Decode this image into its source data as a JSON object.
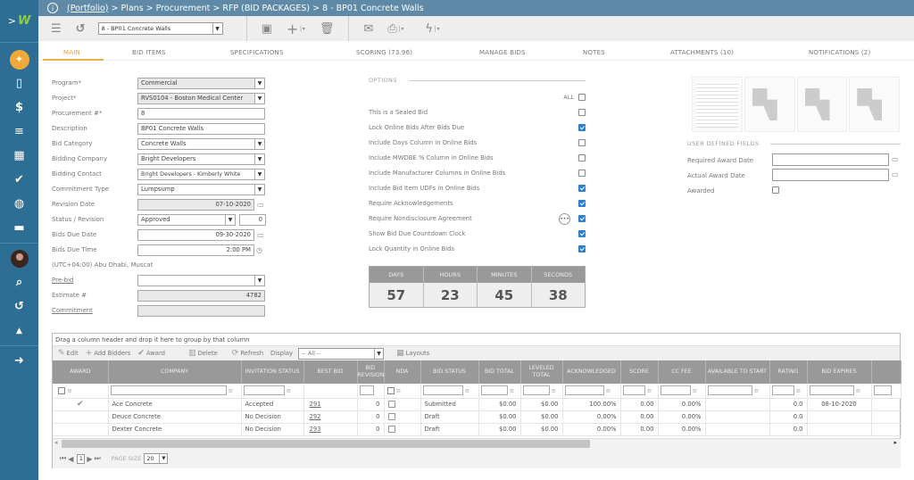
{
  "sidebar": {
    "expand": ">",
    "logo": "W",
    "items": [
      {
        "name": "lightbulb",
        "glyph": "💡"
      },
      {
        "name": "document",
        "glyph": "▯"
      },
      {
        "name": "dollar",
        "glyph": "$"
      },
      {
        "name": "bars",
        "glyph": "≡"
      },
      {
        "name": "building",
        "glyph": "▦"
      },
      {
        "name": "check",
        "glyph": "✔"
      },
      {
        "name": "globe",
        "glyph": "◍"
      },
      {
        "name": "briefcase",
        "glyph": "▬"
      },
      {
        "name": "search",
        "glyph": "⌕"
      },
      {
        "name": "history",
        "glyph": "↺"
      },
      {
        "name": "graduation",
        "glyph": "▲"
      },
      {
        "name": "logout",
        "glyph": "➜"
      }
    ]
  },
  "breadcrumb": {
    "portfolio": "(Portfolio)",
    "rest": "> Plans > Procurement > RFP (BID PACKAGES) > 8 - BP01 Concrete Walls"
  },
  "toolbar": {
    "record_select": "8 -  BP01 Concrete Walls"
  },
  "tabs": [
    "MAIN",
    "BID ITEMS",
    "SPECIFICATIONS",
    "SCORING (73.96)",
    "MANAGE BIDS",
    "NOTES",
    "ATTACHMENTS (10)",
    "NOTIFICATIONS (2)"
  ],
  "form": {
    "program": {
      "label": "Program*",
      "value": "Commercial"
    },
    "project": {
      "label": "Project*",
      "value": "RVS0104 - Boston Medical Center"
    },
    "procurement": {
      "label": "Procurement #*",
      "value": "8"
    },
    "description": {
      "label": "Description",
      "value": "BP01 Concrete Walls"
    },
    "bid_category": {
      "label": "Bid Category",
      "value": "Concrete Walls"
    },
    "bidding_company": {
      "label": "Bidding Company",
      "value": "Bright Developers"
    },
    "bidding_contact": {
      "label": "Bidding Contact",
      "value": "Bright Developers - Kimberly White"
    },
    "commitment_type": {
      "label": "Commitment Type",
      "value": "Lumpsump"
    },
    "revision_date": {
      "label": "Revision Date",
      "value": "07-10-2020"
    },
    "status_revision": {
      "label": "Status / Revision",
      "value": "Approved",
      "revision": "0"
    },
    "bids_due_date": {
      "label": "Bids Due Date",
      "value": "09-30-2020"
    },
    "bids_due_time": {
      "label": "Bids Due Time",
      "value": "2:00 PM"
    },
    "timezone": "(UTC+04:00) Abu Dhabi, Muscat",
    "pre_bid": {
      "label": "Pre-bid",
      "value": ""
    },
    "estimate": {
      "label": "Estimate #",
      "value": "4782"
    },
    "commitment": {
      "label": "Commitment",
      "value": ""
    }
  },
  "options": {
    "heading": "OPTIONS",
    "all_label": "ALL",
    "all_checked": false,
    "items": [
      {
        "label": "This is a Sealed Bid",
        "checked": false
      },
      {
        "label": "Lock Online Bids After Bids Due",
        "checked": true
      },
      {
        "label": "Include Days Column in Online Bids",
        "checked": false
      },
      {
        "label": "Include MWDBE % Column in Online Bids",
        "checked": false
      },
      {
        "label": "Include Manufacturer Columns in Online Bids",
        "checked": false
      },
      {
        "label": "Include Bid Item UDFs in Online Bids",
        "checked": true
      },
      {
        "label": "Require Acknowledgements",
        "checked": true
      },
      {
        "label": "Require Nondisclosure Agreement",
        "checked": true,
        "more": "•••"
      },
      {
        "label": "Show Bid Due Countdown Clock",
        "checked": true
      },
      {
        "label": "Lock Quantity in Online Bids",
        "checked": true
      }
    ]
  },
  "countdown": [
    {
      "label": "DAYS",
      "value": "57"
    },
    {
      "label": "HOURS",
      "value": "23"
    },
    {
      "label": "MINUTES",
      "value": "45"
    },
    {
      "label": "SECONDS",
      "value": "38"
    }
  ],
  "udf": {
    "heading": "USER DEFINED FIELDS",
    "required_award_date": {
      "label": "Required Award Date",
      "value": ""
    },
    "actual_award_date": {
      "label": "Actual Award Date",
      "value": ""
    },
    "awarded": {
      "label": "Awarded",
      "checked": false
    }
  },
  "grid": {
    "group_hint": "Drag a column header and drop it here to group by that column",
    "toolbar": {
      "edit": "Edit",
      "add_bidders": "Add Bidders",
      "award": "Award",
      "delete": "Delete",
      "refresh": "Refresh",
      "display": "Display",
      "display_value": "-- All --",
      "layouts": "Layouts"
    },
    "columns": [
      "AWARD",
      "COMPANY",
      "INVITATION STATUS",
      "BEST BID",
      "BID REVISION",
      "NDA",
      "BID STATUS",
      "BID TOTAL",
      "LEVELED TOTAL",
      "ACKNOWLEDGED",
      "SCORE",
      "CC FEE",
      "AVAILABLE TO START",
      "RATING",
      "BID EXPIRES",
      ""
    ],
    "rows": [
      {
        "award": "✔",
        "company": "Ace Concrete",
        "invitation_status": "Accepted",
        "best_bid": "291",
        "bid_revision": "0",
        "nda": false,
        "bid_status": "Submitted",
        "bid_total": "$0.00",
        "leveled_total": "$0.00",
        "acknowledged": "100.00%",
        "score": "0.00",
        "cc_fee": "0.00%",
        "available_to_start": "",
        "rating": "0.0",
        "bid_expires": "08-10-2020"
      },
      {
        "award": "",
        "company": "Deuce Concrete",
        "invitation_status": "No Decision",
        "best_bid": "292",
        "bid_revision": "0",
        "nda": false,
        "bid_status": "Draft",
        "bid_total": "$0.00",
        "leveled_total": "$0.00",
        "acknowledged": "0.00%",
        "score": "0.00",
        "cc_fee": "0.00%",
        "available_to_start": "",
        "rating": "0.0",
        "bid_expires": ""
      },
      {
        "award": "",
        "company": "Dexter Concrete",
        "invitation_status": "No Decision",
        "best_bid": "293",
        "bid_revision": "0",
        "nda": false,
        "bid_status": "Draft",
        "bid_total": "$0.00",
        "leveled_total": "$0.00",
        "acknowledged": "0.00%",
        "score": "0.00",
        "cc_fee": "0.00%",
        "available_to_start": "",
        "rating": "0.0",
        "bid_expires": ""
      }
    ],
    "pager": {
      "page": "1",
      "page_size_label": "PAGE SIZE",
      "page_size": "20"
    }
  }
}
